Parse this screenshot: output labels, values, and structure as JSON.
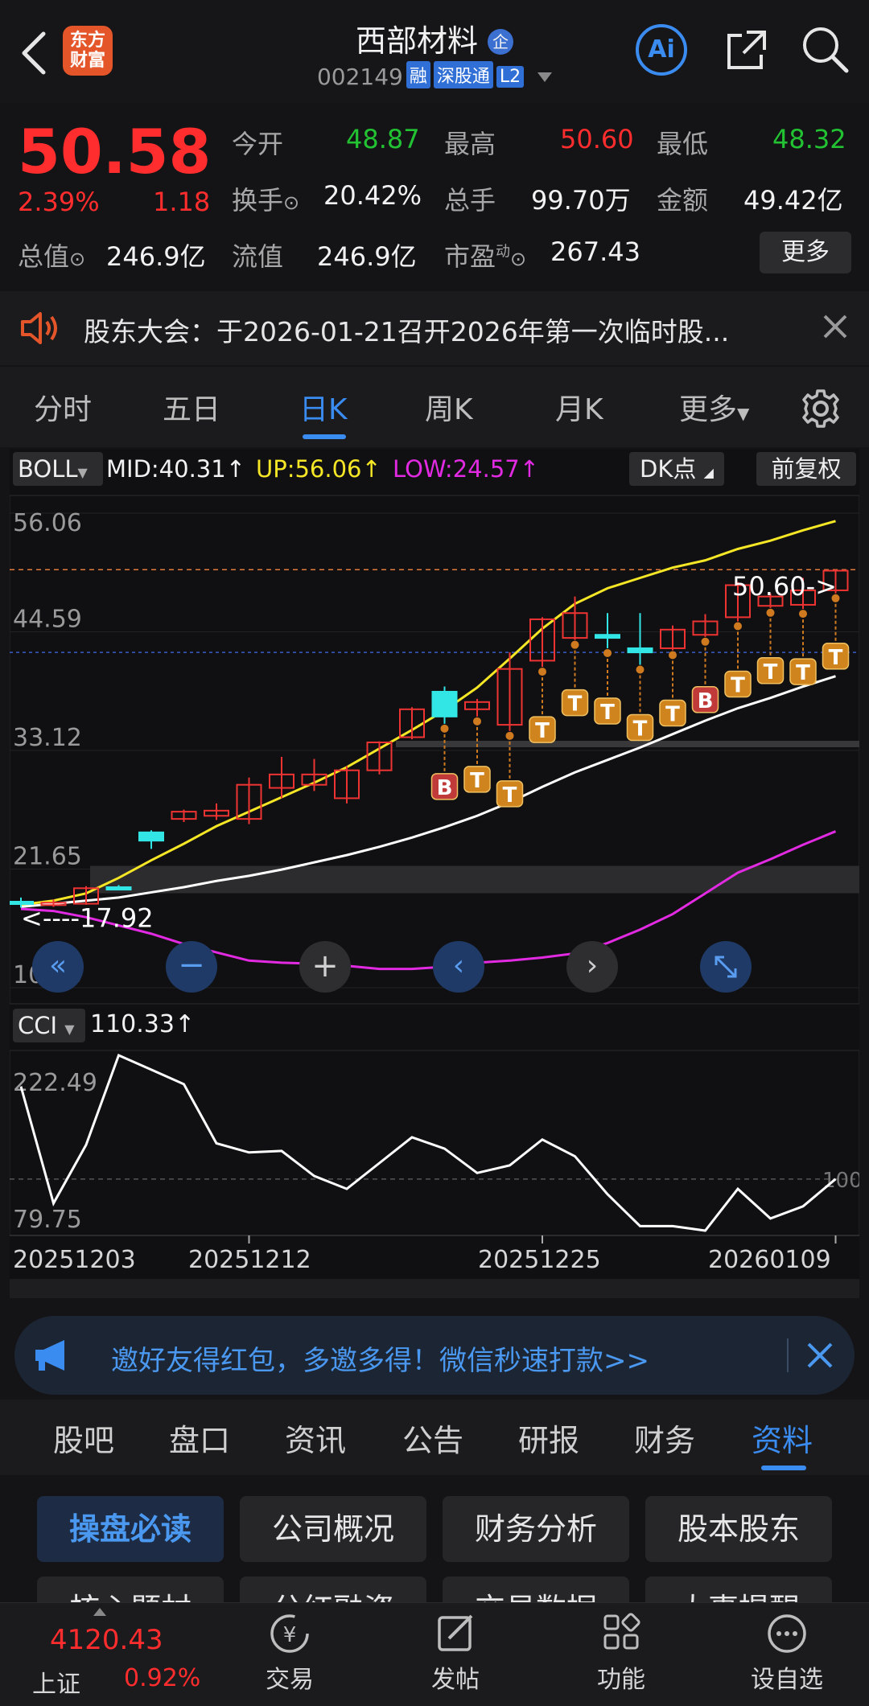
{
  "header": {
    "logo_text": "东方\n财富",
    "stock_name": "西部材料",
    "code": "002149",
    "tags": [
      "融",
      "深股通",
      "L2"
    ],
    "badge": "企",
    "ai_label": "Ai"
  },
  "quote": {
    "price": "50.58",
    "change_pct": "2.39%",
    "change": "1.18",
    "open_label": "今开",
    "open": "48.87",
    "high_label": "最高",
    "high": "50.60",
    "low_label": "最低",
    "low": "48.32",
    "turnover_label": "换手",
    "turnover": "20.42%",
    "volume_label": "总手",
    "volume": "99.70万",
    "amount_label": "金额",
    "amount": "49.42亿",
    "mktcap_label": "总值",
    "mktcap": "246.9亿",
    "float_label": "流值",
    "float": "246.9亿",
    "pe_label": "市盈",
    "pe_sup": "动",
    "pe": "267.43",
    "more_button": "更多"
  },
  "notice": {
    "text": "股东大会：于2026-01-21召开2026年第一次临时股..."
  },
  "kline_tabs": {
    "items": [
      "分时",
      "五日",
      "日K",
      "周K",
      "月K",
      "更多"
    ],
    "active": "日K"
  },
  "indicator_bar": {
    "boll": "BOLL",
    "mid": "MID:40.31↑",
    "up": "UP:56.06↑",
    "low": "LOW:24.57↑",
    "dk": "DK点",
    "adjust": "前复权"
  },
  "chart_data": {
    "type": "candlestick",
    "y_ticks": [
      "56.06",
      "44.59",
      "33.12",
      "21.65",
      "10.18"
    ],
    "ylim": [
      10.18,
      56.06
    ],
    "high_marker": "50.60->",
    "low_marker": "<----17.92",
    "x_labels": [
      "20251203",
      "20251212",
      "20251225",
      "20260109"
    ],
    "candles": [
      {
        "o": 18.5,
        "c": 18.3,
        "h": 18.9,
        "l": 17.92
      },
      {
        "o": 18.2,
        "c": 18.4,
        "h": 18.7,
        "l": 18.0
      },
      {
        "o": 18.3,
        "c": 19.8,
        "h": 20.0,
        "l": 18.2
      },
      {
        "o": 19.9,
        "c": 19.8,
        "h": 20.1,
        "l": 19.6
      },
      {
        "o": 25.2,
        "c": 24.4,
        "h": 25.4,
        "l": 23.6
      },
      {
        "o": 26.5,
        "c": 27.2,
        "h": 27.4,
        "l": 26.2
      },
      {
        "o": 26.8,
        "c": 27.3,
        "h": 28.0,
        "l": 26.4
      },
      {
        "o": 26.5,
        "c": 29.8,
        "h": 30.5,
        "l": 26.0
      },
      {
        "o": 29.5,
        "c": 30.8,
        "h": 32.5,
        "l": 28.5
      },
      {
        "o": 29.8,
        "c": 30.8,
        "h": 32.3,
        "l": 29.2
      },
      {
        "o": 28.5,
        "c": 31.2,
        "h": 31.6,
        "l": 28.0
      },
      {
        "o": 31.2,
        "c": 33.9,
        "h": 34.0,
        "l": 30.8
      },
      {
        "o": 34.4,
        "c": 37.1,
        "h": 37.3,
        "l": 34.2
      },
      {
        "o": 38.8,
        "c": 36.4,
        "h": 39.3,
        "l": 35.7
      },
      {
        "o": 37.1,
        "c": 37.8,
        "h": 38.1,
        "l": 36.4
      },
      {
        "o": 35.6,
        "c": 41.0,
        "h": 42.6,
        "l": 35.0
      },
      {
        "o": 41.8,
        "c": 45.8,
        "h": 46.0,
        "l": 41.2
      },
      {
        "o": 44.0,
        "c": 46.4,
        "h": 48.0,
        "l": 43.8
      },
      {
        "o": 44.3,
        "c": 44.0,
        "h": 46.4,
        "l": 43.0
      },
      {
        "o": 43.0,
        "c": 42.6,
        "h": 46.4,
        "l": 41.4
      },
      {
        "o": 43.0,
        "c": 44.8,
        "h": 45.2,
        "l": 42.8
      },
      {
        "o": 44.3,
        "c": 45.6,
        "h": 46.3,
        "l": 44.1
      },
      {
        "o": 46.0,
        "c": 49.1,
        "h": 49.4,
        "l": 45.6
      },
      {
        "o": 47.1,
        "c": 48.0,
        "h": 48.3,
        "l": 46.9
      },
      {
        "o": 47.2,
        "c": 48.6,
        "h": 49.8,
        "l": 46.8
      },
      {
        "o": 48.6,
        "c": 50.5,
        "h": 50.6,
        "l": 48.3
      }
    ],
    "series": [
      {
        "name": "UP",
        "color": "#f5e626",
        "values": [
          18.2,
          18.6,
          19.3,
          20.8,
          22.5,
          24.1,
          25.8,
          27.2,
          28.6,
          30.0,
          31.5,
          33.3,
          35.1,
          37.0,
          39.2,
          42.0,
          44.9,
          47.3,
          48.8,
          49.8,
          50.8,
          51.5,
          52.6,
          53.4,
          54.4,
          55.3
        ]
      },
      {
        "name": "MID",
        "color": "#ffffff",
        "values": [
          18.0,
          18.3,
          18.6,
          18.9,
          19.4,
          19.9,
          20.5,
          21.0,
          21.6,
          22.3,
          23.0,
          23.8,
          24.7,
          25.7,
          26.8,
          28.1,
          29.6,
          31.0,
          32.2,
          33.4,
          34.7,
          36.0,
          37.2,
          38.2,
          39.3,
          40.3
        ]
      },
      {
        "name": "LOW",
        "color": "#e22ae2",
        "values": [
          17.8,
          17.6,
          17.0,
          16.2,
          15.4,
          14.4,
          13.6,
          12.8,
          12.6,
          12.5,
          12.3,
          12.0,
          12.0,
          12.2,
          12.6,
          12.8,
          13.1,
          13.5,
          14.5,
          15.8,
          17.3,
          19.3,
          21.3,
          22.6,
          24.0,
          25.3
        ]
      }
    ],
    "signals": [
      {
        "i": 13,
        "label": "B"
      },
      {
        "i": 14,
        "label": "T"
      },
      {
        "i": 15,
        "label": "T"
      },
      {
        "i": 16,
        "label": "T"
      },
      {
        "i": 17,
        "label": "T"
      },
      {
        "i": 18,
        "label": "T"
      },
      {
        "i": 19,
        "label": "T"
      },
      {
        "i": 20,
        "label": "T"
      },
      {
        "i": 21,
        "label": "B"
      },
      {
        "i": 22,
        "label": "T"
      },
      {
        "i": 23,
        "label": "T"
      },
      {
        "i": 24,
        "label": "T"
      },
      {
        "i": 25,
        "label": "T"
      }
    ],
    "cci": {
      "label": "CCI",
      "value": "110.33↑",
      "y_ticks": [
        "222.49",
        "79.75"
      ],
      "right_tick": "100",
      "values": [
        222,
        68,
        145,
        263,
        244,
        225,
        147,
        135,
        137,
        104,
        87,
        121,
        155,
        140,
        108,
        118,
        152,
        130,
        80,
        38,
        38,
        32,
        87,
        48,
        64,
        100
      ]
    }
  },
  "chart_controls": [
    "double-left",
    "zoom-out",
    "zoom-in",
    "left",
    "right",
    "fullscreen"
  ],
  "promo": {
    "text": "邀好友得红包，多邀多得！微信秒速打款>>"
  },
  "f10_tabs": {
    "items": [
      "股吧",
      "盘口",
      "资讯",
      "公告",
      "研报",
      "财务",
      "资料"
    ],
    "active": "资料"
  },
  "f10_buttons": [
    "操盘必读",
    "公司概况",
    "财务分析",
    "股本股东",
    "核心题材",
    "分红融资",
    "交易数据",
    "大事提醒"
  ],
  "index": {
    "name": "上证",
    "value": "4120.43",
    "change_pct": "0.92%"
  },
  "bottom_nav": [
    "交易",
    "发帖",
    "功能",
    "设自选"
  ],
  "colors": {
    "up": "#ff2d2d",
    "down": "#22c233",
    "accent": "#3b8cf0"
  }
}
